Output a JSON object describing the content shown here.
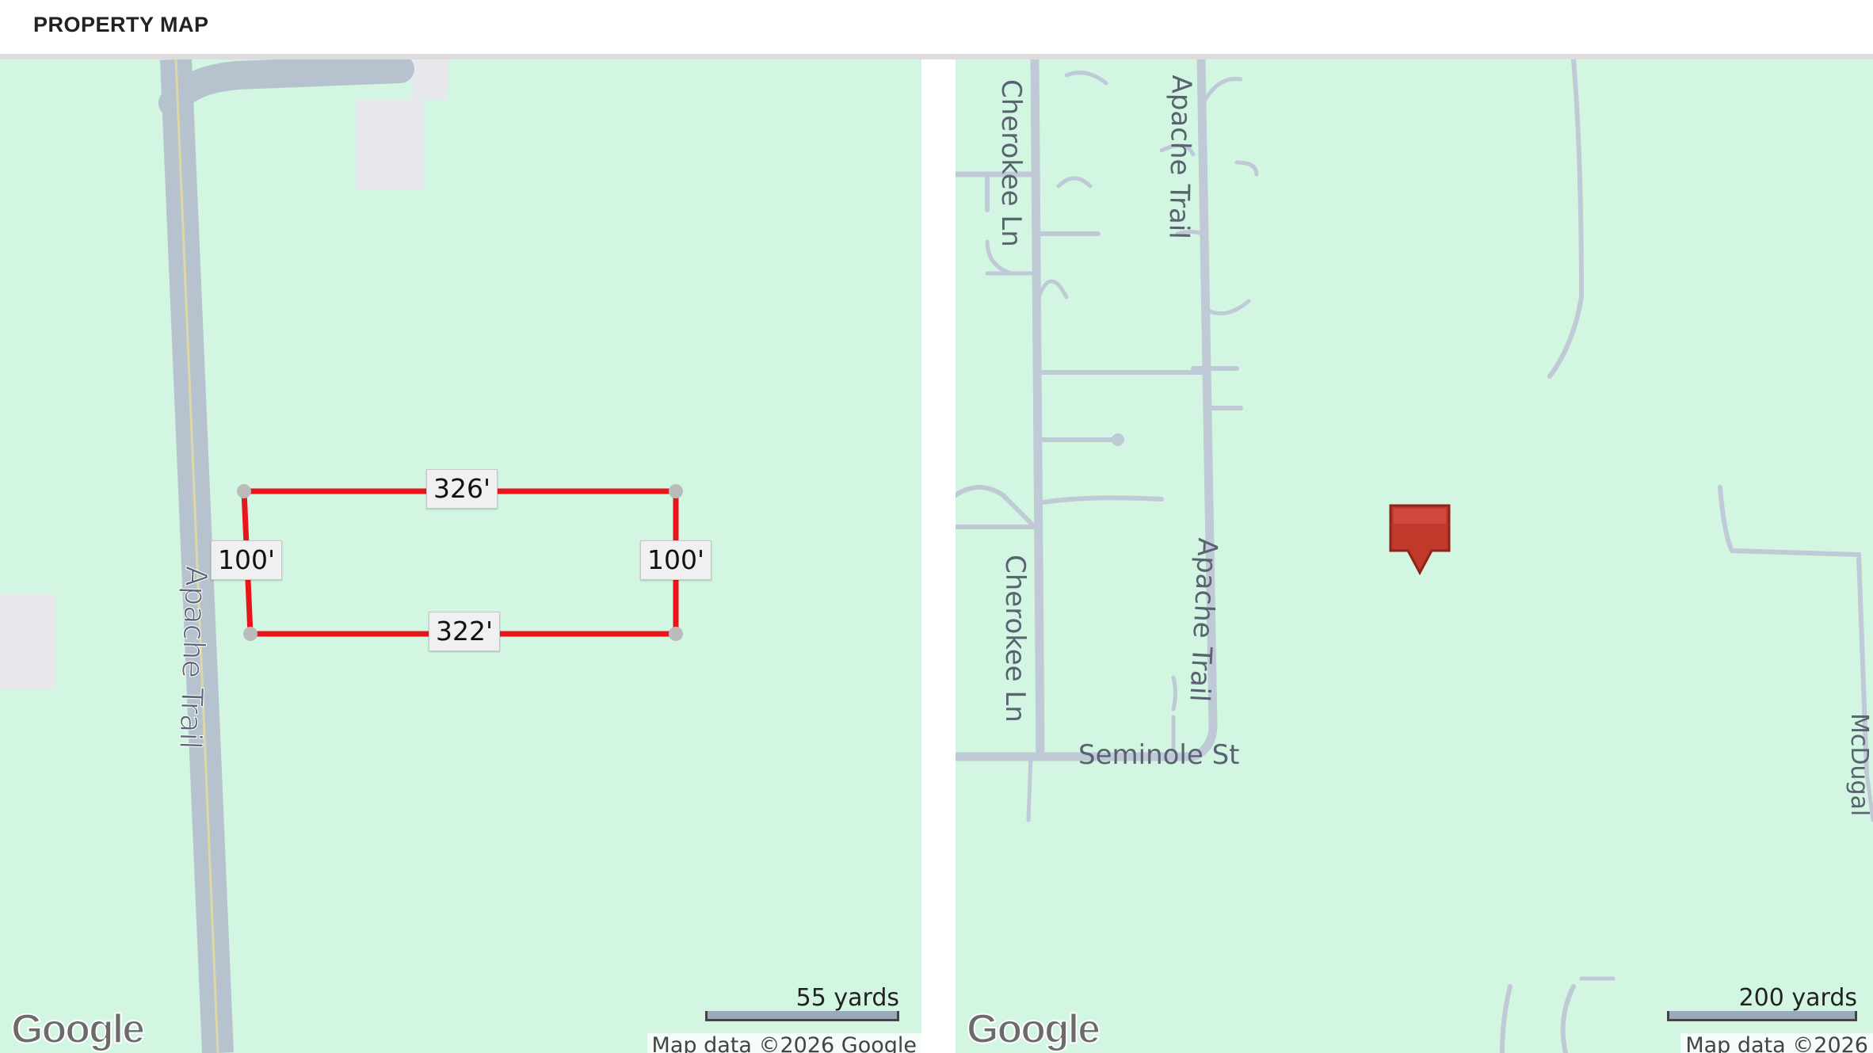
{
  "header": {
    "title": "PROPERTY MAP"
  },
  "left_map": {
    "dimensions": {
      "top": "326'",
      "bottom": "322'",
      "left": "100'",
      "right": "100'"
    },
    "road_label": "Apache Trail",
    "scale_label": "55 yards",
    "attribution": "Map data ©2026 Google",
    "logo": "Google",
    "boundary_color": "#e8151b"
  },
  "right_map": {
    "road_labels": {
      "cherokee_top": "Cherokee Ln",
      "cherokee_bottom": "Cherokee Ln",
      "apache_top": "Apache Trail",
      "apache_bottom": "Apache Trail",
      "seminole": "Seminole St",
      "mcdugal": "McDugal"
    },
    "scale_label": "200 yards",
    "attribution": "Map data ©2026",
    "logo": "Google",
    "marker_color": "#c0392b",
    "marker_icon": "map-pin-icon"
  }
}
